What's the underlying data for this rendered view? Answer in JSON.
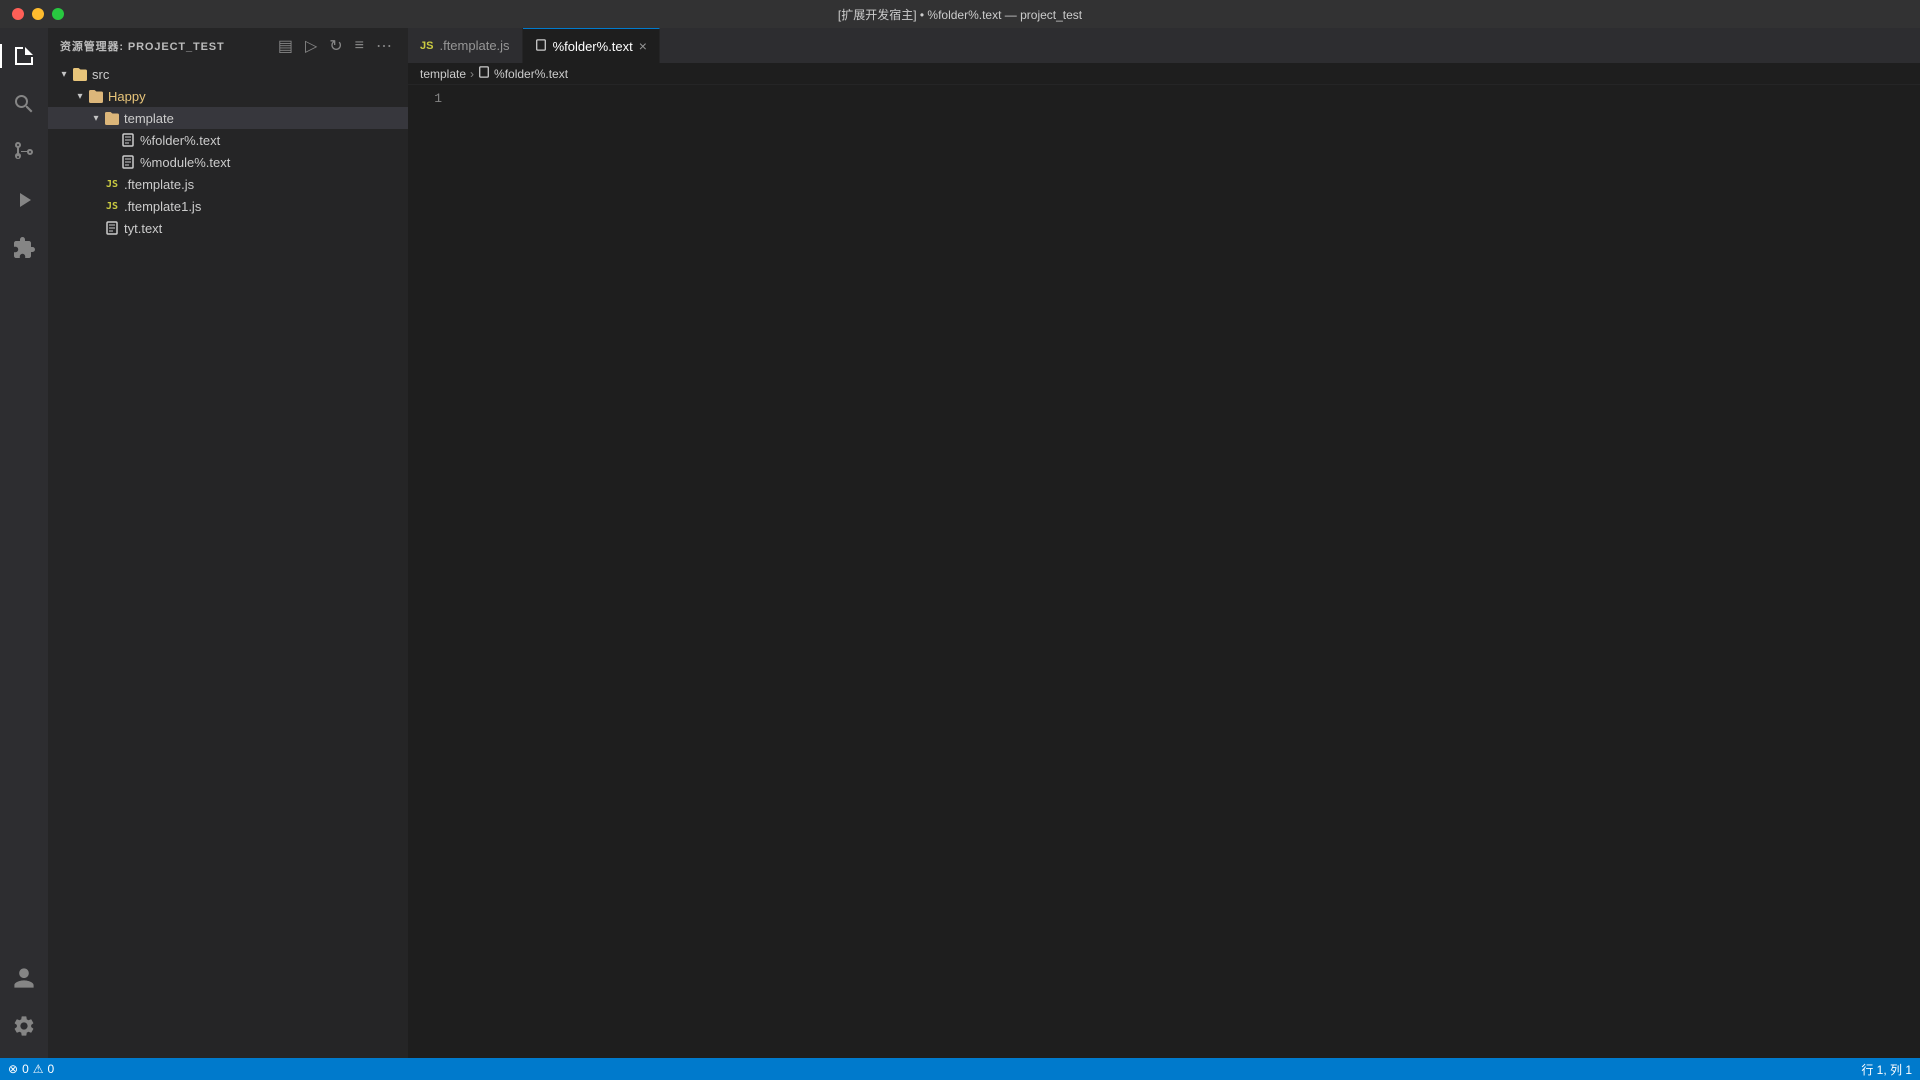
{
  "titlebar": {
    "title": "[扩展开发宿主] • %folder%.text — project_test"
  },
  "activitybar": {
    "icons": [
      {
        "name": "explorer-icon",
        "label": "Explorer",
        "active": true
      },
      {
        "name": "search-icon",
        "label": "Search",
        "active": false
      },
      {
        "name": "source-control-icon",
        "label": "Source Control",
        "active": false
      },
      {
        "name": "run-icon",
        "label": "Run",
        "active": false
      },
      {
        "name": "extensions-icon",
        "label": "Extensions",
        "active": false
      }
    ],
    "bottom_icons": [
      {
        "name": "account-icon",
        "label": "Account",
        "active": false
      },
      {
        "name": "settings-icon",
        "label": "Settings",
        "active": false
      }
    ]
  },
  "sidebar": {
    "header": "资源管理器: PROJECT_TEST",
    "actions": {
      "new_file": "New File",
      "new_folder": "New Folder",
      "refresh": "Refresh",
      "collapse": "Collapse",
      "more": "More Actions"
    },
    "tree": [
      {
        "id": "src",
        "type": "folder-open",
        "label": "src",
        "level": 0,
        "indent": 0,
        "expanded": true
      },
      {
        "id": "happy",
        "type": "folder-open",
        "label": "Happy",
        "level": 1,
        "indent": 16,
        "expanded": true,
        "colored": true
      },
      {
        "id": "template",
        "type": "folder-open",
        "label": "template",
        "level": 2,
        "indent": 32,
        "expanded": true
      },
      {
        "id": "folder-text",
        "type": "file",
        "label": "%folder%.text",
        "level": 3,
        "indent": 48
      },
      {
        "id": "module-text",
        "type": "file",
        "label": "%module%.text",
        "level": 3,
        "indent": 48
      },
      {
        "id": "ftemplate-js",
        "type": "js",
        "label": ".ftemplate.js",
        "level": 2,
        "indent": 32
      },
      {
        "id": "ftemplate1-js",
        "type": "js",
        "label": ".ftemplate1.js",
        "level": 2,
        "indent": 32
      },
      {
        "id": "tyt-text",
        "type": "file",
        "label": "tyt.text",
        "level": 2,
        "indent": 32
      }
    ]
  },
  "tabs": [
    {
      "id": "ftemplate-js-tab",
      "label": ".ftemplate.js",
      "type": "js",
      "active": false
    },
    {
      "id": "folder-text-tab",
      "label": "%folder%.text",
      "type": "text",
      "active": true,
      "closable": true
    }
  ],
  "breadcrumb": [
    {
      "label": "template"
    },
    {
      "label": "%folder%.text"
    }
  ],
  "editor": {
    "line_numbers": [
      "1"
    ],
    "content": ""
  },
  "statusbar": {
    "left": {
      "errors": "0",
      "warnings": "0"
    },
    "right": {
      "position": "行 1, 列 1"
    }
  }
}
